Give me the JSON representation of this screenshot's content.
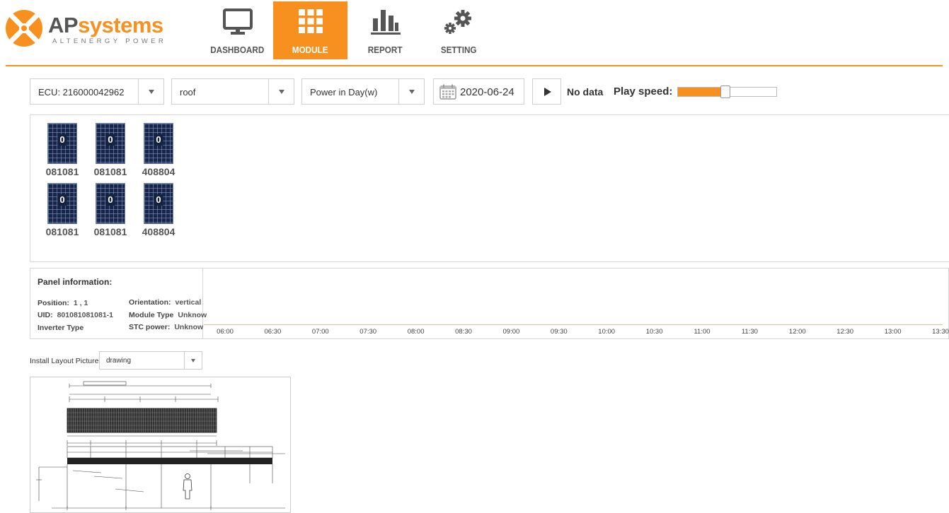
{
  "brand": {
    "name_a": "AP",
    "name_b": "systems",
    "tagline": "ALTENERGY POWER",
    "color_primary": "#f7901e"
  },
  "nav": {
    "items": [
      {
        "label": "DASHBOARD",
        "icon": "monitor-icon",
        "active": false
      },
      {
        "label": "MODULE",
        "icon": "grid-icon",
        "active": true
      },
      {
        "label": "REPORT",
        "icon": "bar-chart-icon",
        "active": false
      },
      {
        "label": "SETTING",
        "icon": "gears-icon",
        "active": false
      }
    ]
  },
  "toolbar": {
    "ecu_select": "ECU: 216000042962",
    "view_select": "roof",
    "metric_select": "Power in Day(w)",
    "date": "2020-06-24",
    "status": "No data",
    "play_speed_label": "Play speed:",
    "play_speed_percent": 48
  },
  "modules": [
    {
      "value": "0",
      "label": "081081"
    },
    {
      "value": "0",
      "label": "081081"
    },
    {
      "value": "0",
      "label": "408804"
    },
    {
      "value": "0",
      "label": "081081"
    },
    {
      "value": "0",
      "label": "081081"
    },
    {
      "value": "0",
      "label": "408804"
    }
  ],
  "panel_info": {
    "title": "Panel information:",
    "position_label": "Position:",
    "position_value": "1 , 1",
    "uid_label": "UID:",
    "uid_value": "801081081081-1",
    "inverter_label": "Inverter Type",
    "orientation_label": "Orientation:",
    "orientation_value": "vertical",
    "module_type_label": "Module Type",
    "module_type_value": "Unknow",
    "stc_label": "STC power:",
    "stc_value": "Unknow"
  },
  "chart_data": {
    "type": "line",
    "x": [
      "06:00",
      "06:30",
      "07:00",
      "07:30",
      "08:00",
      "08:30",
      "09:00",
      "09:30",
      "10:00",
      "10:30",
      "11:00",
      "11:30",
      "12:00",
      "12:30",
      "13:00",
      "13:30"
    ],
    "series": []
  },
  "install": {
    "label": "Install Layout Picture",
    "select": "drawing"
  }
}
